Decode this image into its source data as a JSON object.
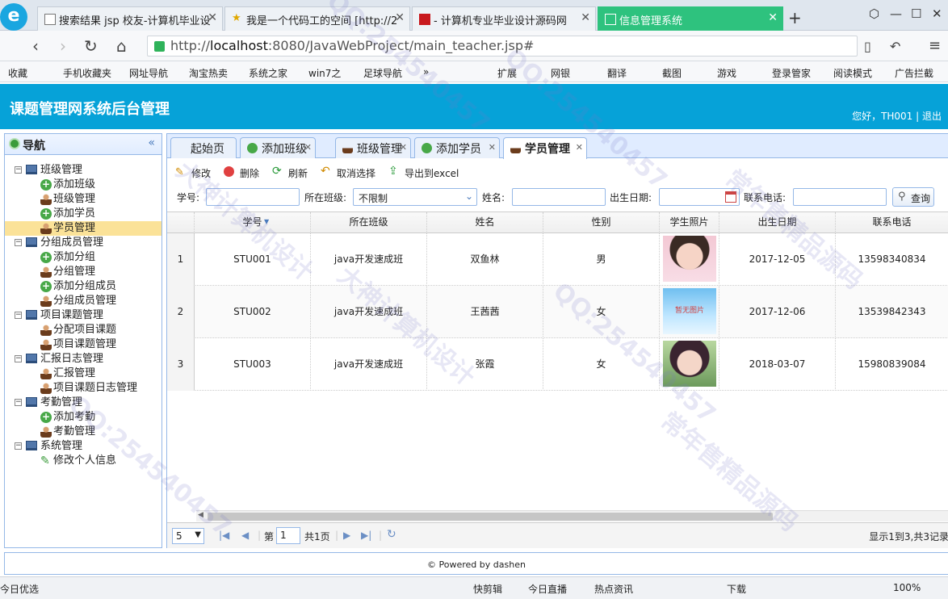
{
  "browser": {
    "tabs": [
      {
        "label": "搜索结果 jsp 校友-计算机毕业设"
      },
      {
        "label": "我是一个代码工的空间 [http://2"
      },
      {
        "label": "- 计算机专业毕业设计源码网"
      },
      {
        "label": "信息管理系统"
      }
    ],
    "url_prefix": "http://",
    "url_host": "localhost",
    "url_rest": ":8080/JavaWebProject/main_teacher.jsp#",
    "bookmarks": [
      "收藏",
      "手机收藏夹",
      "网址导航",
      "淘宝热卖",
      "系统之家",
      "win7之",
      "足球导航",
      "»",
      "扩展",
      "网银",
      "翻译",
      "截图",
      "游戏",
      "登录管家",
      "阅读模式",
      "广告拦截"
    ]
  },
  "app": {
    "title": "课题管理网系统后台管理",
    "welcome": "您好，TH001 | 退出"
  },
  "sidebar": {
    "title": "导航",
    "groups": [
      {
        "label": "班级管理",
        "items": [
          "添加班级",
          "班级管理",
          "添加学员",
          "学员管理"
        ]
      },
      {
        "label": "分组成员管理",
        "items": [
          "添加分组",
          "分组管理",
          "添加分组成员",
          "分组成员管理"
        ]
      },
      {
        "label": "项目课题管理",
        "items": [
          "分配项目课题",
          "项目课题管理"
        ]
      },
      {
        "label": "汇报日志管理",
        "items": [
          "汇报管理",
          "项目课题日志管理"
        ]
      },
      {
        "label": "考勤管理",
        "items": [
          "添加考勤",
          "考勤管理"
        ]
      },
      {
        "label": "系统管理",
        "items": [
          "修改个人信息"
        ]
      }
    ]
  },
  "tabs": [
    "起始页",
    "添加班级",
    "班级管理",
    "添加学员",
    "学员管理"
  ],
  "toolbar": {
    "edit": "修改",
    "delete": "删除",
    "refresh": "刷新",
    "cancel": "取消选择",
    "export": "导出到excel"
  },
  "search": {
    "id_label": "学号:",
    "class_label": "所在班级:",
    "class_value": "不限制",
    "name_label": "姓名:",
    "birth_label": "出生日期:",
    "phone_label": "联系电话:",
    "button": "查询"
  },
  "grid": {
    "columns": [
      "学号",
      "所在班级",
      "姓名",
      "性别",
      "学生照片",
      "出生日期",
      "联系电话"
    ],
    "rows": [
      {
        "num": "1",
        "id": "STU001",
        "class": "java开发速成班",
        "name": "双鱼林",
        "sex": "男",
        "birth": "2017-12-05",
        "phone": "13598340834"
      },
      {
        "num": "2",
        "id": "STU002",
        "class": "java开发速成班",
        "name": "王茜茜",
        "sex": "女",
        "photo_text": "暂无图片",
        "birth": "2017-12-06",
        "phone": "13539842343"
      },
      {
        "num": "3",
        "id": "STU003",
        "class": "java开发速成班",
        "name": "张霞",
        "sex": "女",
        "birth": "2018-03-07",
        "phone": "15980839084"
      }
    ]
  },
  "pager": {
    "size": "5",
    "page_prefix": "第",
    "page": "1",
    "page_suffix": "共1页",
    "info": "显示1到3,共3记录"
  },
  "footer": "© Powered by dashen",
  "statusbar": [
    "今日优选",
    "快剪辑",
    "今日直播",
    "热点资讯",
    "下载",
    "100%"
  ],
  "watermarks": [
    "QQ:254540457",
    "大神计算机设计",
    "常年售精品源码"
  ],
  "colors": {
    "header": "#06a2d8",
    "panel_border": "#95b8e7",
    "selected": "#fbe298"
  }
}
